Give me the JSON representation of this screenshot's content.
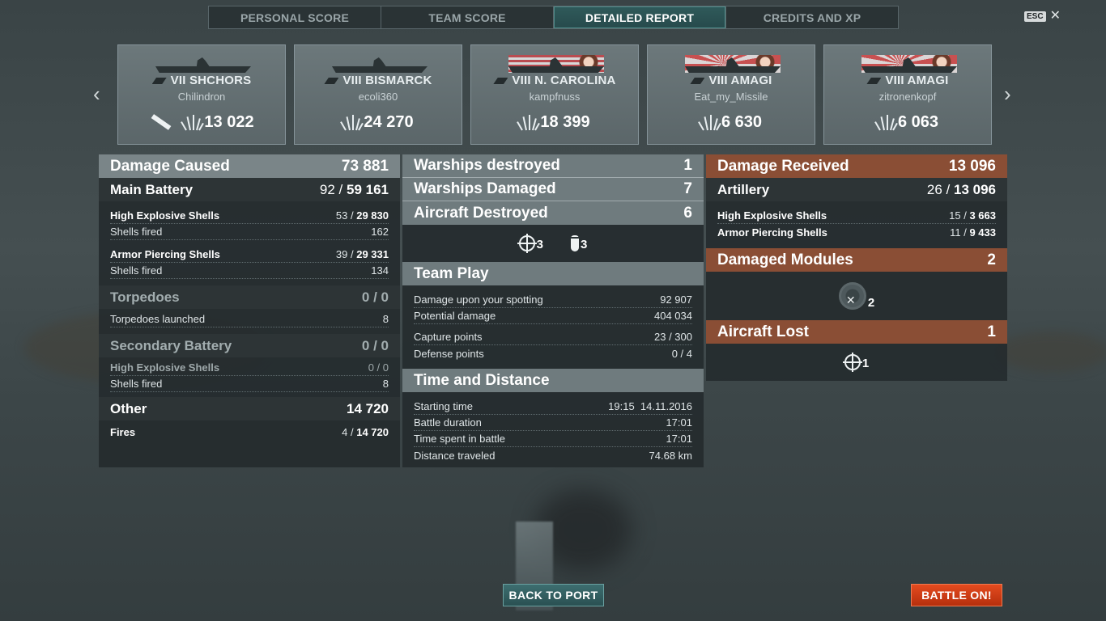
{
  "tabs": [
    {
      "label": "PERSONAL SCORE",
      "active": false
    },
    {
      "label": "TEAM SCORE",
      "active": false
    },
    {
      "label": "DETAILED REPORT",
      "active": true
    },
    {
      "label": "CREDITS AND XP",
      "active": false
    }
  ],
  "esc": {
    "key": "ESC",
    "close": "✕"
  },
  "nav": {
    "prev": "‹",
    "next": "›"
  },
  "ships": [
    {
      "name": "VII SHCHORS",
      "player": "Chilindron",
      "damage": "13 022",
      "sunk": true,
      "art": "plain"
    },
    {
      "name": "VIII BISMARCK",
      "player": "ecoli360",
      "damage": "24 270",
      "sunk": false,
      "art": "plain"
    },
    {
      "name": "VIII N. CAROLINA",
      "player": "kampfnuss",
      "damage": "18 399",
      "sunk": false,
      "art": "us"
    },
    {
      "name": "VIII AMAGI",
      "player": "Eat_my_Missile",
      "damage": "6 630",
      "sunk": false,
      "art": "jp"
    },
    {
      "name": "VIII AMAGI",
      "player": "zitronenkopf",
      "damage": "6 063",
      "sunk": false,
      "art": "jp"
    }
  ],
  "left": {
    "damage_caused": {
      "label": "Damage Caused",
      "value": "73 881"
    },
    "main_battery": {
      "label": "Main Battery",
      "hits": "92",
      "damage": "59 161"
    },
    "he_shells": {
      "label": "High Explosive Shells",
      "hits": "53",
      "damage": "29 830"
    },
    "he_fired": {
      "label": "Shells fired",
      "value": "162"
    },
    "ap_shells": {
      "label": "Armor Piercing Shells",
      "hits": "39",
      "damage": "29 331"
    },
    "ap_fired": {
      "label": "Shells fired",
      "value": "134"
    },
    "torpedoes": {
      "label": "Torpedoes",
      "value": "0 / 0"
    },
    "torp_launched": {
      "label": "Torpedoes launched",
      "value": "8"
    },
    "secondary": {
      "label": "Secondary Battery",
      "value": "0 / 0"
    },
    "sec_he": {
      "label": "High Explosive Shells",
      "value": "0 / 0"
    },
    "sec_fired": {
      "label": "Shells fired",
      "value": "8"
    },
    "other": {
      "label": "Other",
      "value": "14 720"
    },
    "fires": {
      "label": "Fires",
      "hits": "4",
      "damage": "14 720"
    }
  },
  "middle": {
    "warships_destroyed": {
      "label": "Warships destroyed",
      "value": "1"
    },
    "warships_damaged": {
      "label": "Warships Damaged",
      "value": "7"
    },
    "aircraft_destroyed": {
      "label": "Aircraft Destroyed",
      "value": "6"
    },
    "aircraft_icons": [
      {
        "icon": "crosshair-icon",
        "count": "3"
      },
      {
        "icon": "bomb-icon",
        "count": "3"
      }
    ],
    "team_play": {
      "label": "Team Play"
    },
    "spotting": {
      "label": "Damage upon your spotting",
      "value": "92 907"
    },
    "potential": {
      "label": "Potential damage",
      "value": "404 034"
    },
    "capture": {
      "label": "Capture points",
      "value": "23 / 300"
    },
    "defense": {
      "label": "Defense points",
      "value": "0 / 4"
    },
    "time_distance": {
      "label": "Time and Distance"
    },
    "start_time": {
      "label": "Starting time",
      "value": "19:15  14.11.2016"
    },
    "duration": {
      "label": "Battle duration",
      "value": "17:01"
    },
    "time_spent": {
      "label": "Time spent in battle",
      "value": "17:01"
    },
    "distance": {
      "label": "Distance traveled",
      "value": "74.68 km"
    }
  },
  "right": {
    "damage_received": {
      "label": "Damage Received",
      "value": "13 096"
    },
    "artillery": {
      "label": "Artillery",
      "hits": "26",
      "damage": "13 096"
    },
    "he_shells": {
      "label": "High Explosive Shells",
      "hits": "15",
      "damage": "3 663"
    },
    "ap_shells": {
      "label": "Armor Piercing Shells",
      "hits": "11",
      "damage": "9 433"
    },
    "damaged_modules": {
      "label": "Damaged Modules",
      "value": "2"
    },
    "module_count": "2",
    "aircraft_lost": {
      "label": "Aircraft Lost",
      "value": "1"
    },
    "aircraft_lost_count": "1"
  },
  "buttons": {
    "back_to_port": "BACK TO PORT",
    "battle_on": "BATTLE ON!"
  }
}
